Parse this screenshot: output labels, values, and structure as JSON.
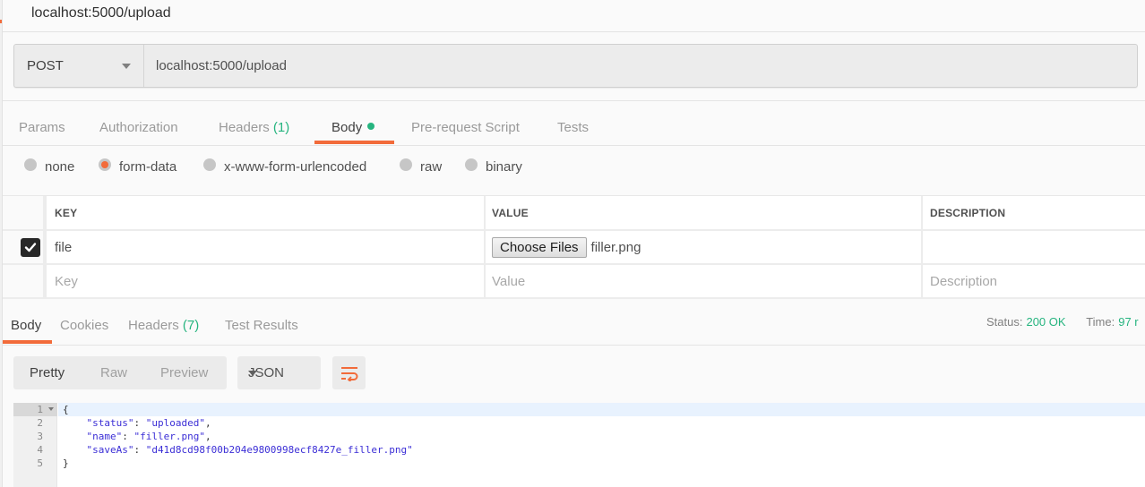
{
  "tab": {
    "title": "localhost:5000/upload"
  },
  "request": {
    "method": "POST",
    "url": "localhost:5000/upload"
  },
  "request_tabs": [
    {
      "label": "Params"
    },
    {
      "label": "Authorization"
    },
    {
      "label": "Headers",
      "count": "(1)"
    },
    {
      "label": "Body",
      "active": true,
      "indicator": "dot"
    },
    {
      "label": "Pre-request Script"
    },
    {
      "label": "Tests"
    }
  ],
  "body_types": [
    {
      "label": "none",
      "checked": false
    },
    {
      "label": "form-data",
      "checked": true
    },
    {
      "label": "x-www-form-urlencoded",
      "checked": false
    },
    {
      "label": "raw",
      "checked": false
    },
    {
      "label": "binary",
      "checked": false
    }
  ],
  "form_table": {
    "headers": {
      "key": "KEY",
      "value": "VALUE",
      "description": "DESCRIPTION"
    },
    "rows": [
      {
        "enabled": true,
        "key": "file",
        "button": "Choose Files",
        "value": "filler.png",
        "description": ""
      }
    ],
    "placeholders": {
      "key": "Key",
      "value": "Value",
      "description": "Description"
    }
  },
  "response_tabs": [
    {
      "label": "Body",
      "active": true
    },
    {
      "label": "Cookies"
    },
    {
      "label": "Headers",
      "count": "(7)"
    },
    {
      "label": "Test Results"
    }
  ],
  "response_meta": {
    "status_label": "Status:",
    "status_value": "200 OK",
    "time_label": "Time:",
    "time_value": "97 r"
  },
  "view_modes": [
    {
      "label": "Pretty",
      "active": true
    },
    {
      "label": "Raw"
    },
    {
      "label": "Preview"
    }
  ],
  "format": {
    "selected": "JSON"
  },
  "wrap_icon": "wrap-lines-icon",
  "colors": {
    "accent": "#f26b3a",
    "success": "#26b47f",
    "code_string": "#3b2ed6"
  },
  "response_body": {
    "line_numbers": [
      "1",
      "2",
      "3",
      "4",
      "5"
    ],
    "lines": [
      {
        "text": "{"
      },
      {
        "key": "\"status\"",
        "value": "\"uploaded\"",
        "trail": ","
      },
      {
        "key": "\"name\"",
        "value": "\"filler.png\"",
        "trail": ","
      },
      {
        "key": "\"saveAs\"",
        "value": "\"d41d8cd98f00b204e9800998ecf8427e_filler.png\"",
        "trail": ""
      },
      {
        "text": "}"
      }
    ]
  }
}
